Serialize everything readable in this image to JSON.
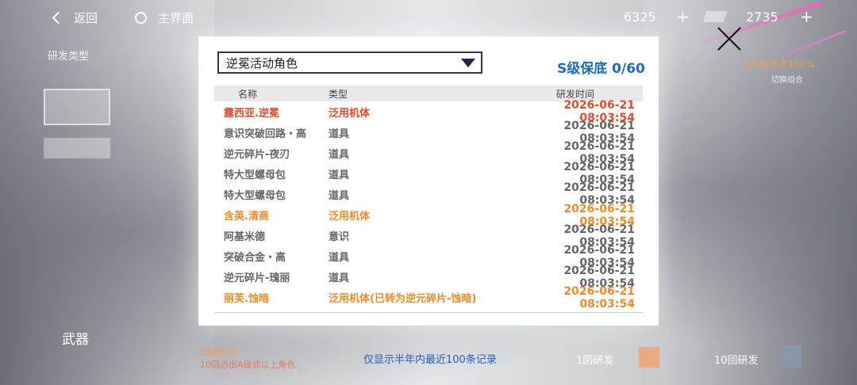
{
  "topbar": {
    "back_label": "返回",
    "home_label": "主界面",
    "currency1": "6325",
    "currency2": "2735",
    "plus": "+"
  },
  "background": {
    "left_type_label": "研发类型",
    "weapon_label": "武器",
    "s_role": "S级角色",
    "s_role_sub": "10回必出A级或以上角色",
    "right_rate": "占S级出率100%",
    "switch_label": "切换组合",
    "once_label": "1回研发",
    "ten_label": "10回研发"
  },
  "modal": {
    "dropdown_value": "逆冕活动角色",
    "guarantee": "S级保底 0/60",
    "headers": {
      "name": "名称",
      "type": "类型",
      "time": "研发时间"
    },
    "rows": [
      {
        "name": "露西亚.逆冕",
        "type": "泛用机体",
        "time": "2026-06-21 08:03:54",
        "rarity": "r"
      },
      {
        "name": "意识突破回路・高",
        "type": "道具",
        "time": "2026-06-21 08:03:54",
        "rarity": "g"
      },
      {
        "name": "逆元碎片-夜刃",
        "type": "道具",
        "time": "2026-06-21 08:03:54",
        "rarity": "g"
      },
      {
        "name": "特大型螺母包",
        "type": "道具",
        "time": "2026-06-21 08:03:54",
        "rarity": "g"
      },
      {
        "name": "特大型螺母包",
        "type": "道具",
        "time": "2026-06-21 08:03:54",
        "rarity": "g"
      },
      {
        "name": "含英.清商",
        "type": "泛用机体",
        "time": "2026-06-21 08:03:54",
        "rarity": "o"
      },
      {
        "name": "阿基米德",
        "type": "意识",
        "time": "2026-06-21 08:03:54",
        "rarity": "g"
      },
      {
        "name": "突破合金・高",
        "type": "道具",
        "time": "2026-06-21 08:03:54",
        "rarity": "g"
      },
      {
        "name": "逆元碎片-瑰丽",
        "type": "道具",
        "time": "2026-06-21 08:03:54",
        "rarity": "g"
      },
      {
        "name": "丽芙.蚀暗",
        "type": "泛用机体(已转为逆元碎片-蚀暗)",
        "time": "2026-06-21 08:03:54",
        "rarity": "o"
      }
    ],
    "note": "仅显示半年内最近100条记录"
  },
  "colors": {
    "accent": "#1f6bbf",
    "s_rank": "#e24a2a",
    "a_rank": "#f08a2a",
    "normal": "#666666"
  }
}
